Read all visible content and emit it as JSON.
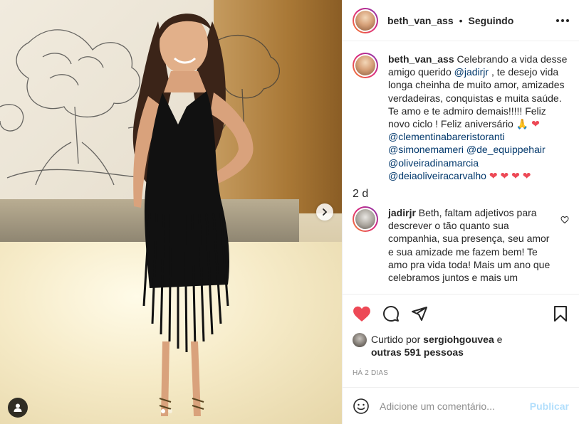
{
  "header": {
    "username": "beth_van_ass",
    "separator": "•",
    "follow_status": "Seguindo",
    "more_icon": "more-options-icon"
  },
  "caption": {
    "username": "beth_van_ass",
    "text_1": "Celebrando a vida desse amigo querido",
    "mention_1": "@jadirjr",
    "text_2": ", te desejo vida longa cheinha de muito amor, amizades verdadeiras, conquistas e muita saúde. Te amo e te admiro demais!!!!! Feliz novo ciclo ! Feliz aniversário",
    "emoji_pray": "🙏",
    "emoji_heart": "❤",
    "mention_2": "@clementinabareristoranti",
    "mention_3": "@simonemameri",
    "mention_4": "@de_equippehair",
    "mention_5": "@oliveiradinamarcia",
    "mention_6": "@deiaoliveiracarvalho",
    "hearts": "❤ ❤ ❤ ❤",
    "time": "2 d"
  },
  "reply": {
    "username": "jadirjr",
    "text": "Beth, faltam adjetivos para descrever o tão quanto sua companhia, sua presença, seu amor e sua amizade me fazem bem! Te amo pra vida toda! Mais um ano que celebramos juntos e mais um"
  },
  "likes": {
    "prefix": "Curtido por",
    "user": "sergiohgouvea",
    "connector": "e",
    "others": "outras 591 pessoas"
  },
  "date": "HÁ 2 DIAS",
  "add_comment": {
    "placeholder": "Adicione um comentário...",
    "publish_label": "Publicar"
  },
  "colors": {
    "like_red": "#ed4956",
    "link_blue": "#00376b",
    "publish_blue": "#0095f6",
    "text": "#262626",
    "muted": "#8e8e8e"
  },
  "carousel": {
    "total": 2,
    "active": 1
  }
}
